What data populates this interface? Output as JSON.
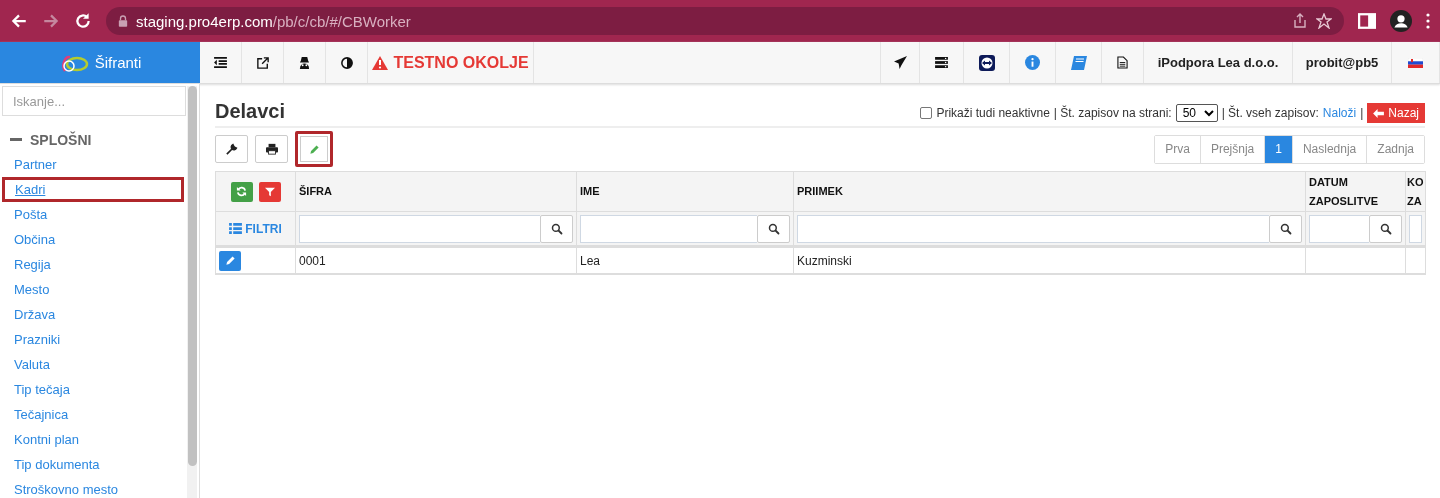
{
  "browser": {
    "url_host": "staging.pro4erp.com",
    "url_path": "/pb/c/cb/#/CBWorker"
  },
  "app_header": {
    "title": "Šifranti",
    "warning": "TESTNO OKOLJE",
    "company": "iPodpora Lea d.o.o.",
    "user": "probit@pb5"
  },
  "sidebar": {
    "search": {
      "placeholder": "Iskanje..."
    },
    "group": {
      "label": "SPLOŠNI",
      "expanded": true
    },
    "items": [
      {
        "label": "Partner",
        "selected": false,
        "highlighted": false
      },
      {
        "label": "Kadri",
        "selected": true,
        "highlighted": true
      },
      {
        "label": "Pošta",
        "selected": false,
        "highlighted": false
      },
      {
        "label": "Občina",
        "selected": false,
        "highlighted": false
      },
      {
        "label": "Regija",
        "selected": false,
        "highlighted": false
      },
      {
        "label": "Mesto",
        "selected": false,
        "highlighted": false
      },
      {
        "label": "Država",
        "selected": false,
        "highlighted": false
      },
      {
        "label": "Prazniki",
        "selected": false,
        "highlighted": false
      },
      {
        "label": "Valuta",
        "selected": false,
        "highlighted": false
      },
      {
        "label": "Tip tečaja",
        "selected": false,
        "highlighted": false
      },
      {
        "label": "Tečajnica",
        "selected": false,
        "highlighted": false
      },
      {
        "label": "Kontni plan",
        "selected": false,
        "highlighted": false
      },
      {
        "label": "Tip dokumenta",
        "selected": false,
        "highlighted": false
      },
      {
        "label": "Stroškovno mesto",
        "selected": false,
        "highlighted": false
      }
    ]
  },
  "main": {
    "title": "Delavci",
    "options": {
      "show_inactive": {
        "label": "Prikaži tudi neaktivne",
        "checked": false
      },
      "per_page_label": "| Št. zapisov na strani:",
      "per_page": "50",
      "total_label": "| Št. vseh zapisov:",
      "load_link": "Naloži",
      "separator": "|",
      "back_button": "Nazaj"
    },
    "toolbar": [
      {
        "highlighted": false
      },
      {
        "highlighted": false
      },
      {
        "highlighted": true
      }
    ],
    "pagination": [
      {
        "label": "Prva",
        "selected": false
      },
      {
        "label": "Prejšnja",
        "selected": false
      },
      {
        "label": "1",
        "selected": true
      },
      {
        "label": "Naslednja",
        "selected": false
      },
      {
        "label": "Zadnja",
        "selected": false
      }
    ],
    "table": {
      "filter_label": "FILTRI",
      "columns": [
        {
          "label": "ŠIFRA"
        },
        {
          "label": "IME"
        },
        {
          "label": "PRIIMEK"
        },
        {
          "label": "DATUM ZAPOSLITVE"
        },
        {
          "label": "KO ZA"
        }
      ],
      "rows": [
        {
          "cells": [
            "0001",
            "Lea",
            "Kuzminski"
          ]
        }
      ]
    }
  }
}
